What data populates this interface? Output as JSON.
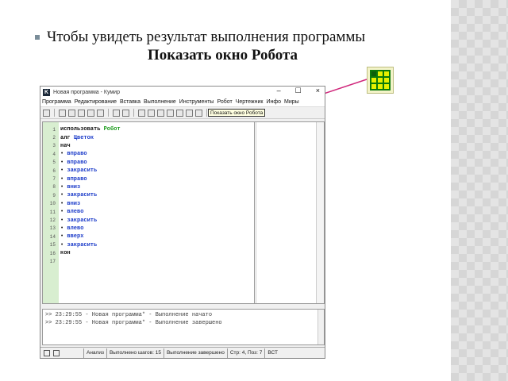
{
  "slide": {
    "bullet_text": "Чтобы увидеть результат выполнения программы",
    "subtitle": "Показать окно Робота"
  },
  "window": {
    "title": "Новая программа - Кумир",
    "app_icon_letter": "K",
    "controls": {
      "minimize": "–",
      "maximize": "☐",
      "close": "×"
    },
    "menu": [
      "Программа",
      "Редактирование",
      "Вставка",
      "Выполнение",
      "Инструменты",
      "Робот",
      "Чертежник",
      "Инфо",
      "Миры"
    ],
    "toolbar_tooltip": "Показать окно Робота",
    "code_lines": [
      {
        "n": "1",
        "parts": [
          {
            "t": "использовать ",
            "c": "kw"
          },
          {
            "t": "Робот",
            "c": "mod"
          }
        ]
      },
      {
        "n": "2",
        "parts": [
          {
            "t": "алг ",
            "c": "kw"
          },
          {
            "t": "Цветок",
            "c": "cmd"
          }
        ]
      },
      {
        "n": "3",
        "parts": [
          {
            "t": "нач",
            "c": "kw"
          }
        ]
      },
      {
        "n": "4",
        "parts": [
          {
            "t": "• ",
            "c": "dot"
          },
          {
            "t": "вправо",
            "c": "cmd"
          }
        ]
      },
      {
        "n": "5",
        "parts": [
          {
            "t": "• ",
            "c": "dot"
          },
          {
            "t": "вправо",
            "c": "cmd"
          }
        ]
      },
      {
        "n": "6",
        "parts": [
          {
            "t": "• ",
            "c": "dot"
          },
          {
            "t": "закрасить",
            "c": "cmd"
          }
        ]
      },
      {
        "n": "7",
        "parts": [
          {
            "t": "• ",
            "c": "dot"
          },
          {
            "t": "вправо",
            "c": "cmd"
          }
        ]
      },
      {
        "n": "8",
        "parts": [
          {
            "t": "• ",
            "c": "dot"
          },
          {
            "t": "вниз",
            "c": "cmd"
          }
        ]
      },
      {
        "n": "9",
        "parts": [
          {
            "t": "• ",
            "c": "dot"
          },
          {
            "t": "закрасить",
            "c": "cmd"
          }
        ]
      },
      {
        "n": "10",
        "parts": [
          {
            "t": "• ",
            "c": "dot"
          },
          {
            "t": "вниз",
            "c": "cmd"
          }
        ]
      },
      {
        "n": "11",
        "parts": [
          {
            "t": "• ",
            "c": "dot"
          },
          {
            "t": "влево",
            "c": "cmd"
          }
        ]
      },
      {
        "n": "12",
        "parts": [
          {
            "t": "• ",
            "c": "dot"
          },
          {
            "t": "закрасить",
            "c": "cmd"
          }
        ]
      },
      {
        "n": "13",
        "parts": [
          {
            "t": "• ",
            "c": "dot"
          },
          {
            "t": "влево",
            "c": "cmd"
          }
        ]
      },
      {
        "n": "14",
        "parts": [
          {
            "t": "• ",
            "c": "dot"
          },
          {
            "t": "вверх",
            "c": "cmd"
          }
        ]
      },
      {
        "n": "15",
        "parts": [
          {
            "t": "• ",
            "c": "dot"
          },
          {
            "t": "закрасить",
            "c": "cmd"
          }
        ]
      },
      {
        "n": "16",
        "parts": [
          {
            "t": "кон",
            "c": "kw"
          }
        ]
      },
      {
        "n": "17",
        "parts": []
      }
    ],
    "console_lines": [
      ">> 23:29:55 - Новая программа* - Выполнение начато",
      ">> 23:29:55 - Новая программа* - Выполнение завершено"
    ],
    "status": {
      "mode": "Анализ",
      "steps": "Выполнено шагов: 15",
      "state": "Выполнение завершено",
      "position": "Стр: 4, Поз: 7",
      "ins": "ВСТ"
    }
  }
}
